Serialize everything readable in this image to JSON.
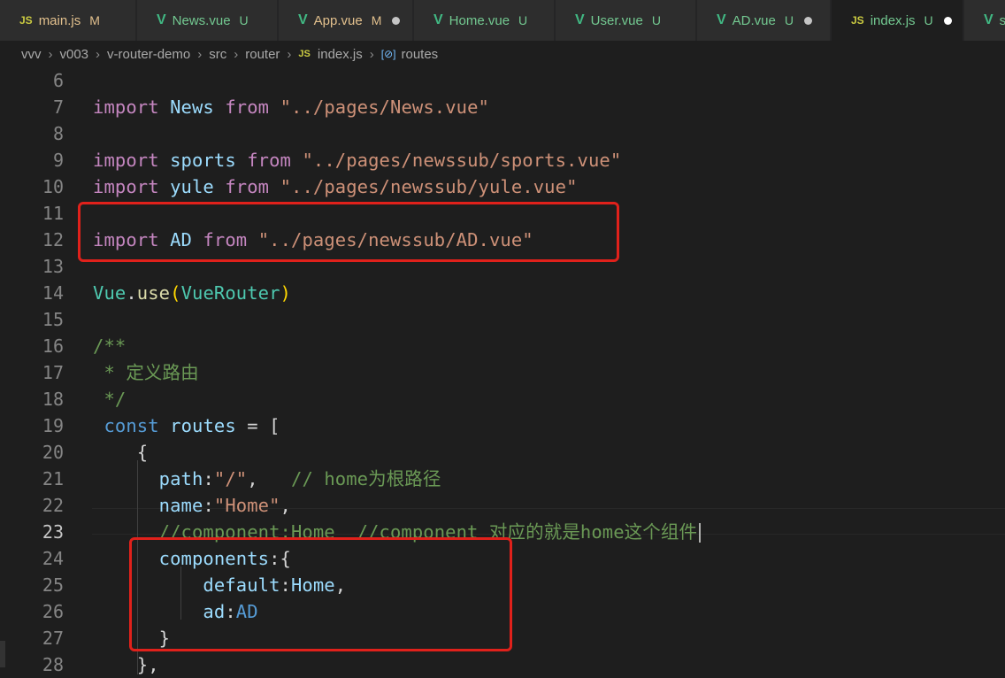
{
  "tabs": [
    {
      "icon": "JS",
      "kind": "js",
      "name": "main.js",
      "status": "M",
      "status_color": "#e2c08d",
      "name_color": "#e2c08d"
    },
    {
      "icon": "V",
      "kind": "vue",
      "name": "News.vue",
      "status": "U",
      "status_color": "#73c991",
      "name_color": "#73c991"
    },
    {
      "icon": "V",
      "kind": "vue",
      "name": "App.vue",
      "status": "M",
      "status_color": "#e2c08d",
      "name_color": "#e2c08d",
      "dirty": true
    },
    {
      "icon": "V",
      "kind": "vue",
      "name": "Home.vue",
      "status": "U",
      "status_color": "#73c991",
      "name_color": "#73c991"
    },
    {
      "icon": "V",
      "kind": "vue",
      "name": "User.vue",
      "status": "U",
      "status_color": "#73c991",
      "name_color": "#73c991"
    },
    {
      "icon": "V",
      "kind": "vue",
      "name": "AD.vue",
      "status": "U",
      "status_color": "#73c991",
      "name_color": "#73c991",
      "dirty": true
    },
    {
      "icon": "JS",
      "kind": "js",
      "name": "index.js",
      "status": "U",
      "status_color": "#73c991",
      "name_color": "#73c991",
      "dirty": true,
      "active": true
    },
    {
      "icon": "V",
      "kind": "vue",
      "name": "s",
      "status": "",
      "status_color": "#73c991",
      "name_color": "#73c991"
    }
  ],
  "breadcrumb": {
    "parts": [
      "vvv",
      "v003",
      "v-router-demo",
      "src",
      "router"
    ],
    "file_badge": "JS",
    "file": "index.js",
    "symbol_icon": "[⊘]",
    "symbol": "routes"
  },
  "lines": [
    {
      "n": "6",
      "tokens": []
    },
    {
      "n": "7",
      "tokens": [
        [
          "kw",
          "import"
        ],
        [
          "pn",
          " "
        ],
        [
          "vr",
          "News"
        ],
        [
          "pn",
          " "
        ],
        [
          "kw",
          "from"
        ],
        [
          "pn",
          " "
        ],
        [
          "st",
          "\"../pages/News.vue\""
        ]
      ]
    },
    {
      "n": "8",
      "tokens": []
    },
    {
      "n": "9",
      "tokens": [
        [
          "kw",
          "import"
        ],
        [
          "pn",
          " "
        ],
        [
          "vr",
          "sports"
        ],
        [
          "pn",
          " "
        ],
        [
          "kw",
          "from"
        ],
        [
          "pn",
          " "
        ],
        [
          "st",
          "\"../pages/newssub/sports.vue\""
        ]
      ]
    },
    {
      "n": "10",
      "tokens": [
        [
          "kw",
          "import"
        ],
        [
          "pn",
          " "
        ],
        [
          "vr",
          "yule"
        ],
        [
          "pn",
          " "
        ],
        [
          "kw",
          "from"
        ],
        [
          "pn",
          " "
        ],
        [
          "st",
          "\"../pages/newssub/yule.vue\""
        ]
      ]
    },
    {
      "n": "11",
      "tokens": []
    },
    {
      "n": "12",
      "tokens": [
        [
          "kw",
          "import"
        ],
        [
          "pn",
          " "
        ],
        [
          "vr",
          "AD"
        ],
        [
          "pn",
          " "
        ],
        [
          "kw",
          "from"
        ],
        [
          "pn",
          " "
        ],
        [
          "st",
          "\"../pages/newssub/AD.vue\""
        ]
      ]
    },
    {
      "n": "13",
      "tokens": []
    },
    {
      "n": "14",
      "tokens": [
        [
          "cl",
          "Vue"
        ],
        [
          "pn",
          "."
        ],
        [
          "fn",
          "use"
        ],
        [
          "br",
          "("
        ],
        [
          "cl",
          "VueRouter"
        ],
        [
          "br",
          ")"
        ]
      ]
    },
    {
      "n": "15",
      "tokens": []
    },
    {
      "n": "16",
      "tokens": [
        [
          "cm",
          "/**"
        ]
      ]
    },
    {
      "n": "17",
      "tokens": [
        [
          "cm",
          " * 定义路由"
        ]
      ]
    },
    {
      "n": "18",
      "tokens": [
        [
          "cm",
          " */"
        ]
      ]
    },
    {
      "n": "19",
      "tokens": [
        [
          "pn",
          " "
        ],
        [
          "bl",
          "const"
        ],
        [
          "pn",
          " "
        ],
        [
          "vr",
          "routes"
        ],
        [
          "pn",
          " = "
        ],
        [
          "pn",
          "["
        ]
      ]
    },
    {
      "n": "20",
      "tokens": [
        [
          "pn",
          "    "
        ],
        [
          "pn",
          "{"
        ]
      ]
    },
    {
      "n": "21",
      "tokens": [
        [
          "pn",
          "      "
        ],
        [
          "vr",
          "path"
        ],
        [
          "pn",
          ":"
        ],
        [
          "st",
          "\"/\""
        ],
        [
          "pn",
          ",   "
        ],
        [
          "cm",
          "// home为根路径"
        ]
      ]
    },
    {
      "n": "22",
      "tokens": [
        [
          "pn",
          "      "
        ],
        [
          "vr",
          "name"
        ],
        [
          "pn",
          ":"
        ],
        [
          "st",
          "\"Home\""
        ],
        [
          "pn",
          ","
        ]
      ]
    },
    {
      "n": "23",
      "tokens": [
        [
          "pn",
          "      "
        ],
        [
          "cm",
          "//component:Home  //component 对应的就是home这个组件"
        ]
      ],
      "current": true
    },
    {
      "n": "24",
      "tokens": [
        [
          "pn",
          "      "
        ],
        [
          "vr",
          "components"
        ],
        [
          "pn",
          ":{"
        ]
      ]
    },
    {
      "n": "25",
      "tokens": [
        [
          "pn",
          "          "
        ],
        [
          "vr",
          "default"
        ],
        [
          "pn",
          ":"
        ],
        [
          "vr",
          "Home"
        ],
        [
          "pn",
          ","
        ]
      ]
    },
    {
      "n": "26",
      "tokens": [
        [
          "pn",
          "          "
        ],
        [
          "vr",
          "ad"
        ],
        [
          "pn",
          ":"
        ],
        [
          "bl",
          "AD"
        ]
      ]
    },
    {
      "n": "27",
      "tokens": [
        [
          "pn",
          "      "
        ],
        [
          "pn",
          "}"
        ]
      ]
    },
    {
      "n": "28",
      "tokens": [
        [
          "pn",
          "    "
        ],
        [
          "pn",
          "},"
        ]
      ]
    }
  ]
}
